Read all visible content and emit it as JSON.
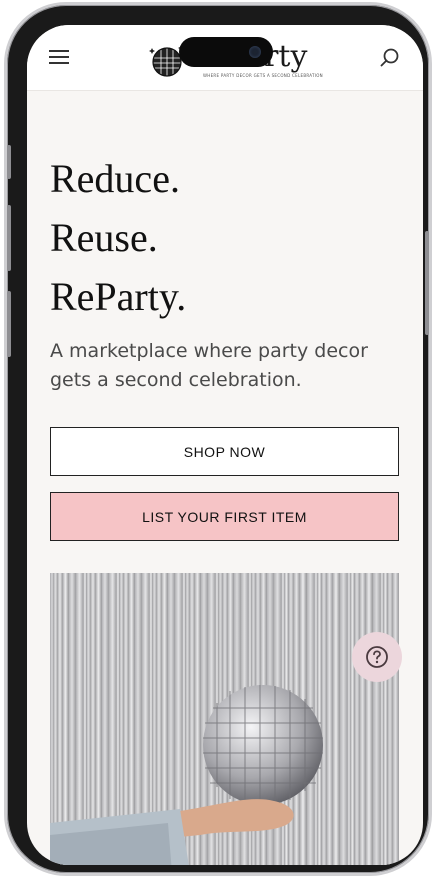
{
  "header": {
    "logo_word": "ReParty",
    "logo_tagline": "WHERE PARTY DECOR GETS A SECOND CELEBRATION",
    "menu_icon": "hamburger-menu-icon",
    "search_icon": "search-icon"
  },
  "hero": {
    "line1": "Reduce.",
    "line2": "Reuse.",
    "line3": "ReParty.",
    "tagline": "A marketplace where party decor gets a second celebration."
  },
  "buttons": {
    "shop_now": "SHOP NOW",
    "list_item": "LIST YOUR FIRST ITEM"
  },
  "help": {
    "icon": "question-mark-icon",
    "label": "?"
  },
  "colors": {
    "accent_pink": "#f6c4c6",
    "help_bg": "#ecd6dc",
    "page_bg": "#f8f6f4"
  }
}
